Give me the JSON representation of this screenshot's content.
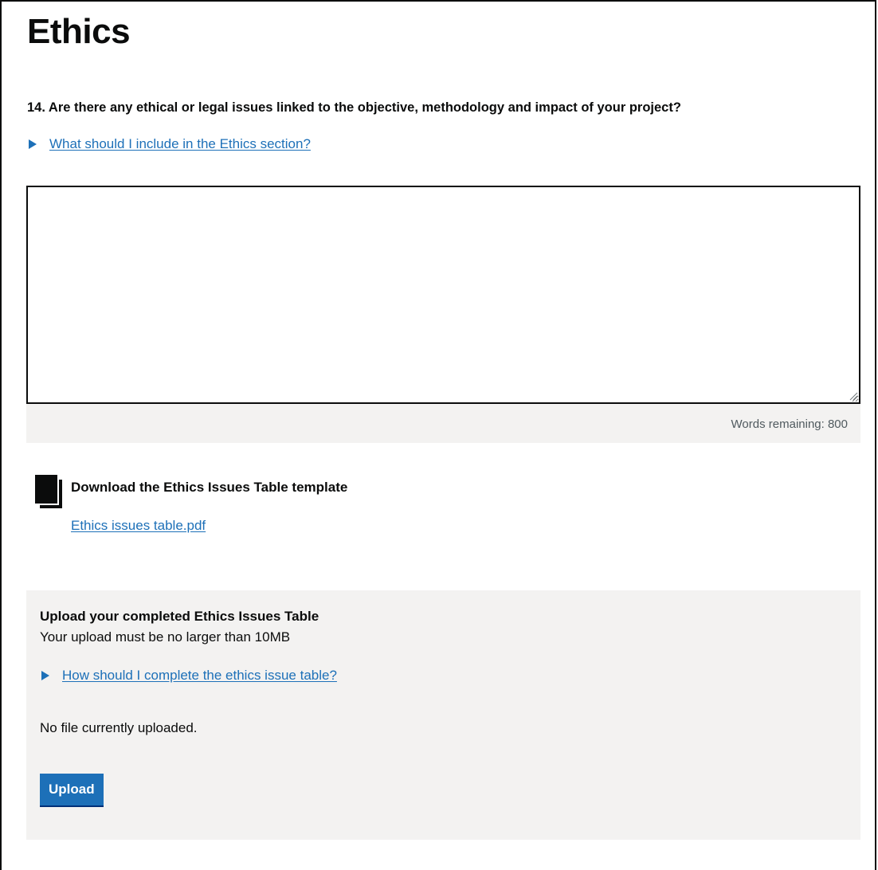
{
  "page": {
    "title": "Ethics"
  },
  "question": {
    "label": "14. Are there any ethical or legal issues linked to the objective, methodology and impact of your project?",
    "guidance_summary": "What should I include in the Ethics section?",
    "textarea_value": "",
    "words_remaining": "Words remaining: 800"
  },
  "download": {
    "icon": "document-icon",
    "heading": "Download the Ethics Issues Table template",
    "link_text": "Ethics issues table.pdf"
  },
  "upload": {
    "heading": "Upload your completed Ethics Issues Table",
    "hint": "Your upload must be no larger than 10MB",
    "guidance_summary": "How should I complete the ethics issue table?",
    "status": "No file currently uploaded.",
    "button_label": "Upload"
  },
  "colors": {
    "link": "#1d70b8",
    "text": "#0b0c0c",
    "panel_background": "#f3f2f1",
    "button_background": "#1d70b8"
  }
}
